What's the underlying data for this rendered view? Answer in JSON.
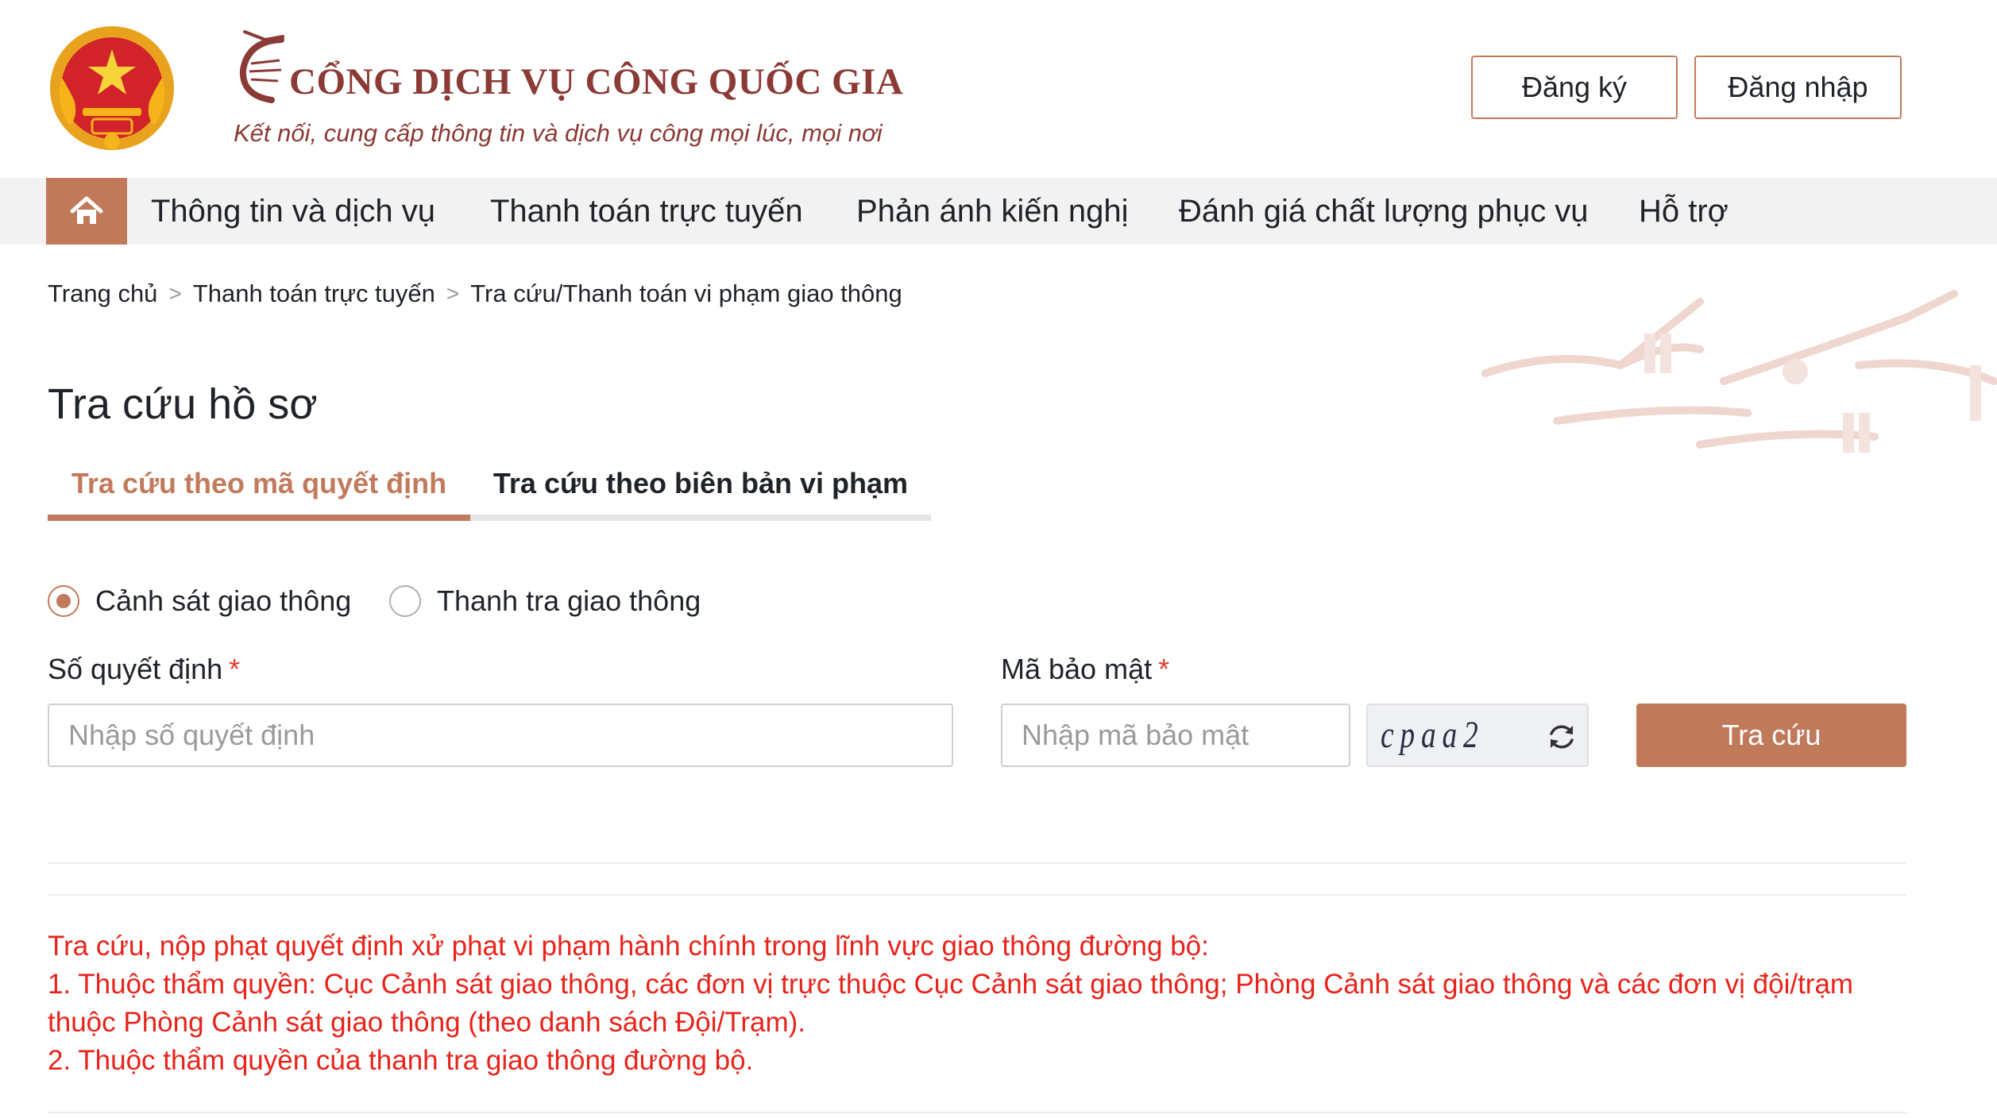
{
  "header": {
    "title": "CỔNG DỊCH VỤ CÔNG QUỐC GIA",
    "subtitle": "Kết nối, cung cấp thông tin và dịch vụ công mọi lúc, mọi nơi",
    "register_label": "Đăng ký",
    "login_label": "Đăng nhập"
  },
  "nav": {
    "items": [
      {
        "label": "Thông tin và dịch vụ"
      },
      {
        "label": "Thanh toán trực tuyến"
      },
      {
        "label": "Phản ánh kiến nghị"
      },
      {
        "label": "Đánh giá chất lượng phục vụ"
      },
      {
        "label": "Hỗ trợ"
      }
    ]
  },
  "breadcrumb": {
    "items": [
      "Trang chủ",
      "Thanh toán trực tuyến",
      "Tra cứu/Thanh toán vi phạm giao thông"
    ],
    "separator": ">"
  },
  "page": {
    "title": "Tra cứu hồ sơ",
    "tabs": [
      {
        "label": "Tra cứu theo mã quyết định",
        "active": true
      },
      {
        "label": "Tra cứu theo biên bản vi phạm",
        "active": false
      }
    ]
  },
  "form": {
    "radios": [
      {
        "label": "Cảnh sát giao thông",
        "checked": true
      },
      {
        "label": "Thanh tra giao thông",
        "checked": false
      }
    ],
    "decision_label": "Số quyết định",
    "decision_placeholder": "Nhập số quyết định",
    "decision_value": "",
    "security_label": "Mã bảo mật",
    "security_placeholder": "Nhập mã bảo mật",
    "security_value": "",
    "required_mark": "*",
    "captcha_text": "cpaa2",
    "submit_label": "Tra cứu"
  },
  "notes": {
    "heading": "Tra cứu, nộp phạt quyết định xử phạt vi phạm hành chính trong lĩnh vực giao thông đường bộ:",
    "line1": "1. Thuộc thẩm quyền: Cục Cảnh sát giao thông, các đơn vị trực thuộc Cục Cảnh sát giao thông; Phòng Cảnh sát giao thông và các đơn vị đội/trạm thuộc Phòng Cảnh sát giao thông (theo danh sách Đội/Trạm).",
    "line2": "2. Thuộc thẩm quyền của thanh tra giao thông đường bộ."
  },
  "colors": {
    "brand": "#8b3a35",
    "accent": "#c07a5a",
    "nav_bg": "#f2f2f2",
    "note_text": "#e8231a"
  },
  "icons": {
    "emblem": "national-emblem",
    "brand_mark": "crane-letter-c",
    "home": "home-icon",
    "refresh": "refresh-icon"
  }
}
